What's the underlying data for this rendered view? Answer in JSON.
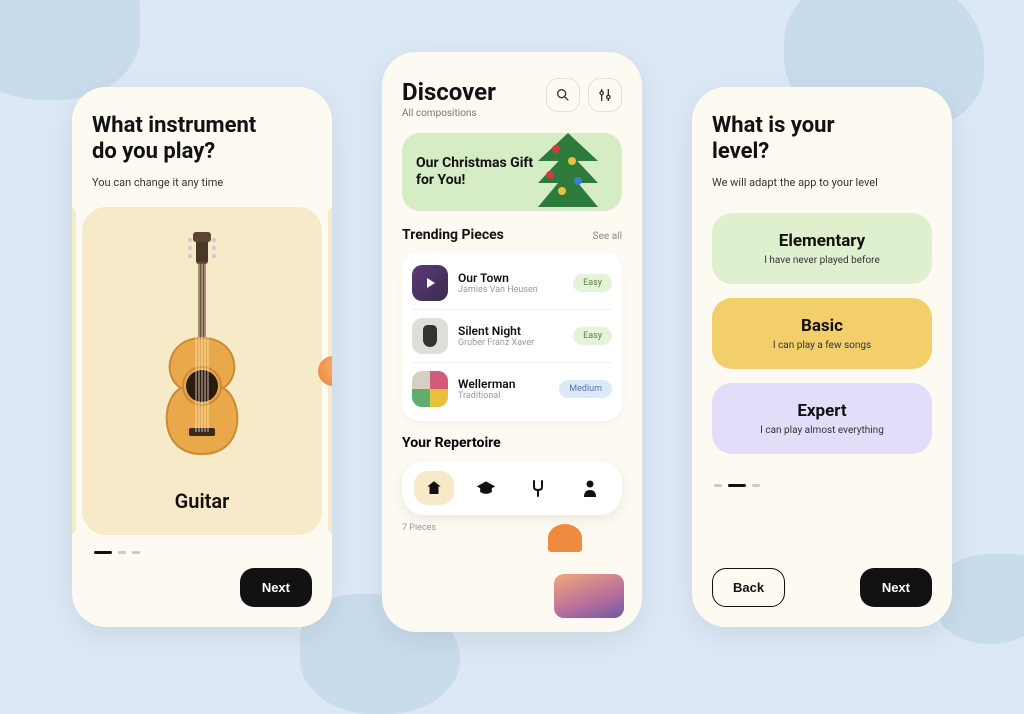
{
  "screen1": {
    "title_line1": "What instrument",
    "title_line2": "do you play?",
    "subtitle": "You can change it any time",
    "card_label": "Guitar",
    "next": "Next"
  },
  "screen2": {
    "title": "Discover",
    "subtitle": "All compositions",
    "promo": "Our Christmas Gift for You!",
    "trending_title": "Trending Pieces",
    "see_all": "See all",
    "pieces": [
      {
        "name": "Our Town",
        "composer": "Jamies Van Heusen",
        "badge": "Easy"
      },
      {
        "name": "Silent Night",
        "composer": "Gruber Franz Xaver",
        "badge": "Easy"
      },
      {
        "name": "Wellerman",
        "composer": "Traditional",
        "badge": "Medium"
      }
    ],
    "repertoire_title": "Your Repertoire",
    "repertoire_meta": "7 Pieces"
  },
  "screen3": {
    "title_line1": "What is your",
    "title_line2": "level?",
    "subtitle": "We will adapt the app to your level",
    "levels": [
      {
        "title": "Elementary",
        "sub": "I have never played before"
      },
      {
        "title": "Basic",
        "sub": "I can play a few songs"
      },
      {
        "title": "Expert",
        "sub": "I can play almost everything"
      }
    ],
    "back": "Back",
    "next": "Next"
  }
}
